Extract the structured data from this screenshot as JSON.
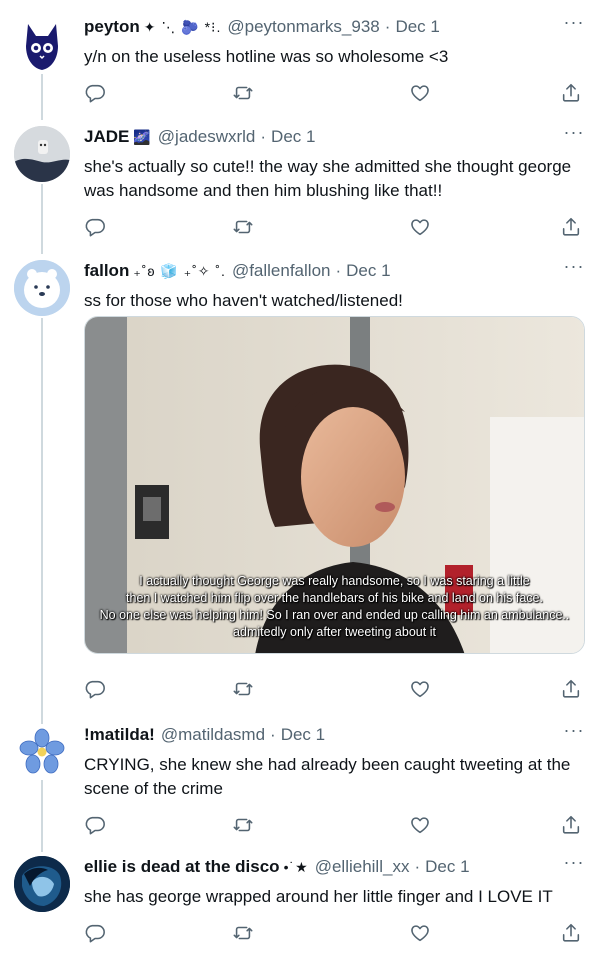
{
  "tweets": [
    {
      "name": "peyton",
      "decoration": "✦ ⋱ 🫐 *⁝.",
      "handle": "@peytonmarks_938",
      "separator": "·",
      "date": "Dec 1",
      "text": "y/n on the useless hotline was so wholesome <3",
      "avatar_icon": "black-cat-icon"
    },
    {
      "name": "JADE",
      "decoration": "🌌",
      "handle": "@jadeswxrld",
      "separator": "·",
      "date": "Dec 1",
      "text": "she's actually so cute!! the way she admitted she thought george was handsome and then him blushing like that!!",
      "avatar_icon": "avatar-photo"
    },
    {
      "name": "fallon",
      "decoration": "₊˚ʚ 🧊 ₊˚✧ ˚.",
      "handle": "@fallenfallon",
      "separator": "·",
      "date": "Dec 1",
      "text": "ss for those who haven't watched/listened!",
      "avatar_icon": "polar-bear-icon",
      "media": {
        "subtitle_lines": [
          "I actually thought George was really handsome, so I was staring a little",
          "then I watched him flip over the handlebars of his bike and land on his face.",
          "No one else was helping him! So I ran over and ended up calling him an ambulance..",
          "admitedly only after tweeting about it"
        ]
      }
    },
    {
      "name": "!matilda!",
      "decoration": "",
      "handle": "@matildasmd",
      "separator": "·",
      "date": "Dec 1",
      "text": "CRYING, she knew she had already been caught tweeting at the scene of the crime",
      "avatar_icon": "blue-flower-icon"
    },
    {
      "name": "ellie is dead at the disco",
      "decoration": "•˙★",
      "handle": "@elliehill_xx",
      "separator": "·",
      "date": "Dec 1",
      "text": "she has george wrapped around her little finger and I LOVE IT",
      "avatar_icon": "avatar-photo-blue"
    }
  ],
  "more_label": "···",
  "colors": {
    "text": "#0f1419",
    "secondary": "#536471",
    "thread_line": "#cfd9de"
  }
}
